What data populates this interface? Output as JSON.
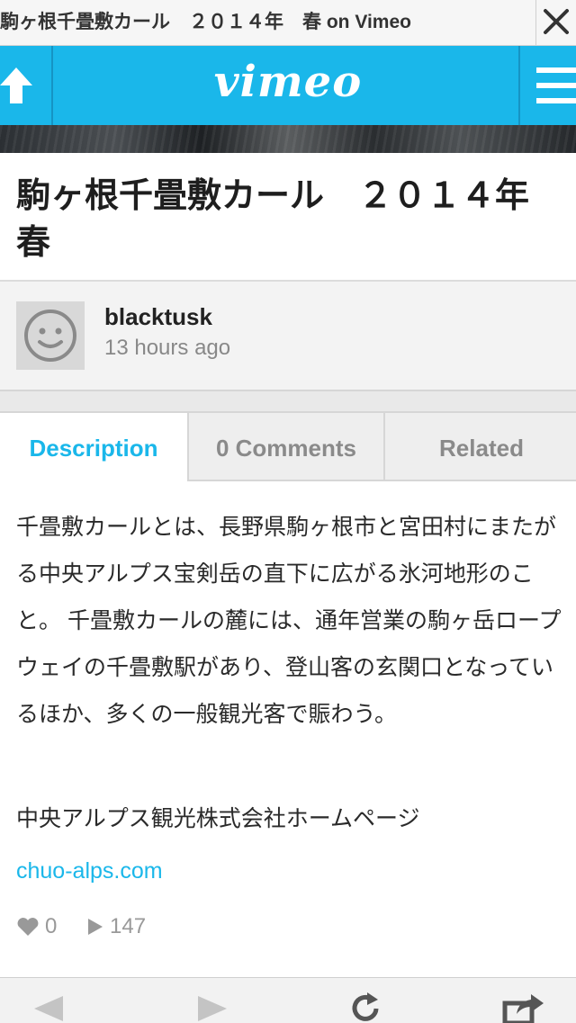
{
  "browser": {
    "title": "駒ヶ根千畳敷カール　２０１４年　春 on Vimeo"
  },
  "header": {
    "logo": "vimeo",
    "brand_color": "#1ab7ea"
  },
  "video": {
    "title": "駒ヶ根千畳敷カール　２０１４年　春"
  },
  "author": {
    "name": "blacktusk",
    "time": "13 hours ago"
  },
  "tabs": [
    {
      "label": "Description",
      "active": true
    },
    {
      "label": "0 Comments",
      "active": false
    },
    {
      "label": "Related",
      "active": false
    }
  ],
  "description": {
    "text": "千畳敷カールとは、長野県駒ヶ根市と宮田村にまたがる中央アルプス宝剣岳の直下に広がる氷河地形のこと。 千畳敷カールの麓には、通年営業の駒ヶ岳ロープウェイの千畳敷駅があり、登山客の玄関口となっているほか、多くの一般観光客で賑わう。",
    "promo": "中央アルプス観光株式会社ホームページ",
    "link": "chuo-alps.com"
  },
  "stats": {
    "likes": "0",
    "plays": "147"
  },
  "icons": {
    "close": "close-icon",
    "up": "arrow-up-icon",
    "menu": "hamburger-menu-icon",
    "avatar": "smiley-avatar-icon",
    "like": "heart-icon",
    "play": "play-icon",
    "back": "back-arrow-icon",
    "forward": "forward-arrow-icon",
    "reload": "reload-icon",
    "share": "share-icon"
  }
}
